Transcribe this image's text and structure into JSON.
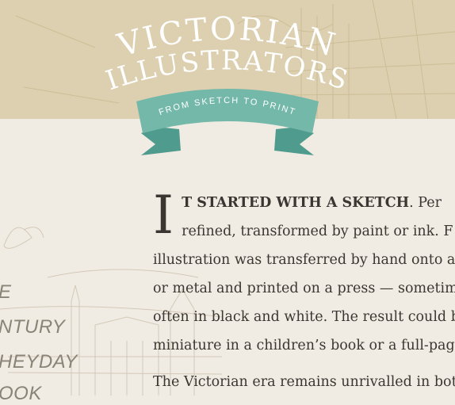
{
  "header": {
    "title_line1": "VICTORIAN",
    "title_line2": "ILLUSTRATORS",
    "ribbon_text": "FROM SKETCH TO PRINT"
  },
  "colors": {
    "header_bg": "#ddd0b0",
    "ribbon": "#74b8aa",
    "page_bg": "#f1ece3",
    "text": "#3b3632"
  },
  "sidebar": {
    "items": [
      {
        "label": "E"
      },
      {
        "label": "NTURY"
      },
      {
        "label": "HEYDAY"
      },
      {
        "label": "OOK"
      }
    ]
  },
  "article": {
    "dropcap": "I",
    "lead": "T STARTED WITH A SKETCH",
    "p1_lines": [
      ". Per",
      "refined, transformed by paint or ink. F",
      "illustration was transferred by hand onto a",
      "or metal and printed on a press — sometim",
      "often in black and white. The result could b",
      "miniature in a children’s book or a full-pag"
    ],
    "p2": "The Victorian era remains unrivalled in bot"
  }
}
